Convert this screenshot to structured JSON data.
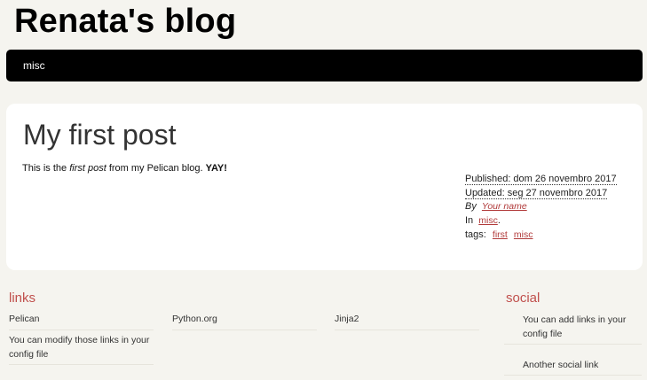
{
  "header": {
    "site_title": "Renata's blog"
  },
  "menu": {
    "items": [
      {
        "label": "misc"
      }
    ]
  },
  "article": {
    "title": "My first post",
    "body": {
      "prefix": "This is the ",
      "emphasis": "first post",
      "middle": " from my Pelican blog. ",
      "strong": "YAY!"
    },
    "info": {
      "published": "Published: dom 26 novembro 2017",
      "updated": "Updated: seg 27 novembro 2017",
      "by_label": "By",
      "author": "Your name",
      "in_label": "In",
      "category": "misc",
      "category_suffix": ".",
      "tags_label": "tags:",
      "tags": [
        "first",
        "misc"
      ]
    }
  },
  "extras": {
    "links": {
      "title": "links",
      "items": [
        {
          "label": "Pelican"
        },
        {
          "label": "Python.org"
        },
        {
          "label": "Jinja2"
        },
        {
          "label": "You can modify those links in your config file"
        }
      ]
    },
    "social": {
      "title": "social",
      "items": [
        {
          "label": "You can add links in your config file"
        },
        {
          "label": "Another social link"
        }
      ]
    }
  },
  "colors": {
    "page_background": "#f5f4ef",
    "menu_background": "#000000",
    "accent_red": "#c0504d",
    "link_red": "#b13a3a"
  }
}
